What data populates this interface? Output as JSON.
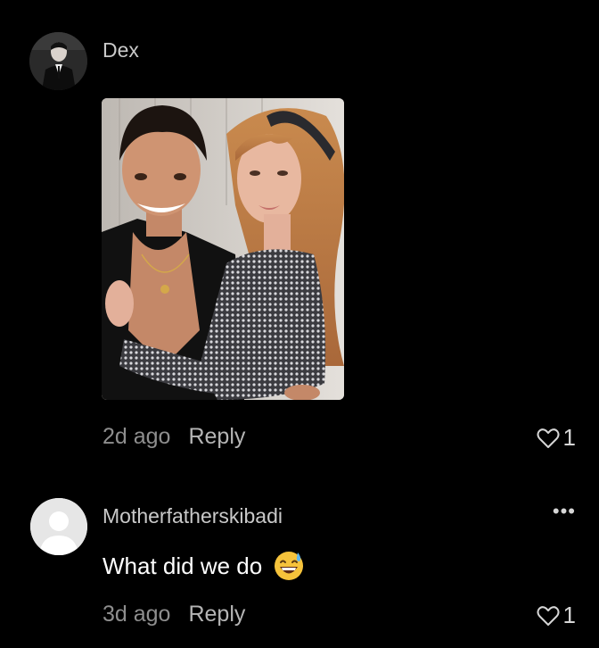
{
  "comments": [
    {
      "username": "Dex",
      "avatar_icon": "user-photo-icon",
      "has_image": true,
      "time": "2d ago",
      "reply_label": "Reply",
      "likes": "1"
    },
    {
      "username": "Motherfatherskibadi",
      "avatar_icon": "default-avatar-icon",
      "text": "What did we do",
      "emoji": "grinning-face-with-sweat-emoji",
      "time": "3d ago",
      "reply_label": "Reply",
      "likes": "1",
      "more_label": "•••"
    }
  ],
  "colors": {
    "background": "#000000",
    "username": "#c9c9c9",
    "timestamp": "#8e8e8e",
    "reply": "#b5b5b5",
    "text": "#ffffff"
  }
}
